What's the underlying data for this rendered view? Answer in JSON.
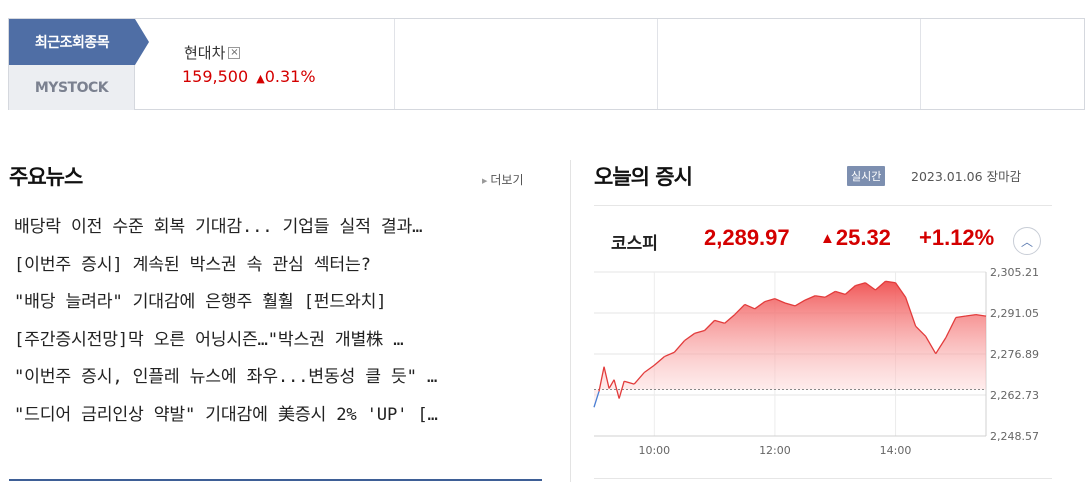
{
  "recent_stocks": {
    "tab_recent": "최근조회종목",
    "tab_mystock": "MYSTOCK",
    "items": [
      {
        "name": "현대차",
        "price": "159,500",
        "direction_icon": "up-triangle-icon",
        "change_symbol": "▲",
        "change": "0.31%",
        "remove_icon": "close-icon"
      }
    ]
  },
  "news": {
    "title": "주요뉴스",
    "more_label": "더보기",
    "items": [
      "배당락 이전 수준 회복 기대감... 기업들 실적 결과…",
      "[이번주 증시] 계속된 박스권 속 관심 섹터는?",
      "\"배당 늘려라\" 기대감에 은행주 훨훨 [펀드와치]",
      "[주간증시전망]막 오른 어닝시즌…\"박스권 개별株 …",
      "\"이번주 증시, 인플레 뉴스에 좌우...변동성 클 듯\" …",
      "\"드디어 금리인상 약발\" 기대감에 美증시 2% 'UP' […"
    ]
  },
  "market": {
    "title": "오늘의 증시",
    "live_badge": "실시간",
    "date": "2023.01.06",
    "status": "장마감",
    "index_name": "코스피",
    "index_value": "2,289.97",
    "change_symbol": "▲",
    "change_value": "25.32",
    "change_rate": "+1.12%",
    "collapse_icon": "chevron-up-icon",
    "colors": {
      "up": "#d40000",
      "accent": "#4f6ea5",
      "below_prev": "#4a7fd4"
    }
  },
  "chart_data": {
    "type": "area",
    "title": "",
    "xlabel": "",
    "ylabel": "",
    "x_ticks": [
      "10:00",
      "12:00",
      "14:00"
    ],
    "y_ticks": [
      "2,305.21",
      "2,291.05",
      "2,276.89",
      "2,262.73",
      "2,248.57"
    ],
    "ylim": [
      2248.57,
      2305.21
    ],
    "xlim": [
      "09:00",
      "15:30"
    ],
    "previous_close": 2264.65,
    "grid": true,
    "series": [
      {
        "x": [
          "09:00",
          "09:05",
          "09:10",
          "09:15",
          "09:20",
          "09:25",
          "09:30",
          "09:40",
          "09:50",
          "10:00",
          "10:10",
          "10:20",
          "10:30",
          "10:40",
          "10:50",
          "11:00",
          "11:10",
          "11:20",
          "11:30",
          "11:40",
          "11:50",
          "12:00",
          "12:10",
          "12:20",
          "12:30",
          "12:40",
          "12:50",
          "13:00",
          "13:10",
          "13:20",
          "13:30",
          "13:40",
          "13:50",
          "14:00",
          "14:10",
          "14:20",
          "14:30",
          "14:40",
          "14:50",
          "15:00",
          "15:10",
          "15:20",
          "15:30"
        ],
        "y": [
          2258.5,
          2264.0,
          2272.5,
          2265.0,
          2268.0,
          2261.5,
          2267.5,
          2266.5,
          2270.5,
          2273.0,
          2276.0,
          2277.5,
          2281.5,
          2284.0,
          2285.0,
          2288.5,
          2287.5,
          2290.5,
          2294.0,
          2292.5,
          2295.0,
          2296.0,
          2294.5,
          2293.5,
          2295.5,
          2297.0,
          2296.5,
          2298.5,
          2297.5,
          2300.5,
          2301.5,
          2299.0,
          2302.0,
          2301.5,
          2296.5,
          2286.5,
          2283.0,
          2277.0,
          2282.5,
          2289.5,
          2290.0,
          2290.5,
          2289.97
        ]
      }
    ]
  }
}
